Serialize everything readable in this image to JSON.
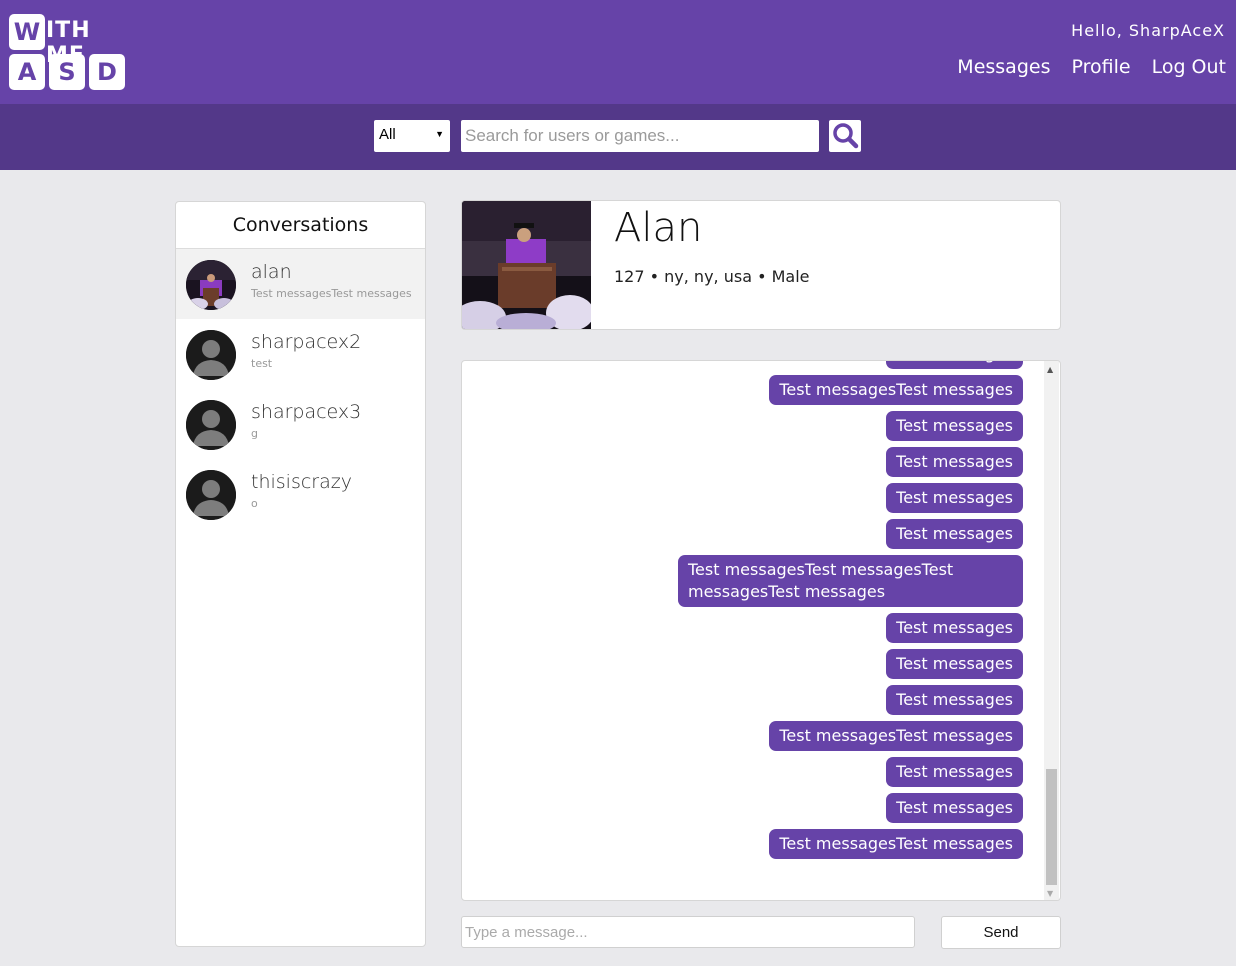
{
  "header": {
    "logo": {
      "tile_w": "W",
      "word": "ITH ME",
      "tiles": [
        "A",
        "S",
        "D"
      ]
    },
    "greeting": "Hello, SharpAceX",
    "nav": [
      "Messages",
      "Profile",
      "Log Out"
    ]
  },
  "search": {
    "category": "All",
    "placeholder": "Search for users or games..."
  },
  "conversations": {
    "title": "Conversations",
    "items": [
      {
        "name": "alan",
        "preview": "Test messagesTest messages"
      },
      {
        "name": "sharpacex2",
        "preview": "test"
      },
      {
        "name": "sharpacex3",
        "preview": "g"
      },
      {
        "name": "thisiscrazy",
        "preview": "o"
      }
    ]
  },
  "profile": {
    "name": "Alan",
    "info": "127 • ny, ny, usa • Male"
  },
  "messages": [
    "Test messages",
    "Test messagesTest messages",
    "Test messages",
    "Test messages",
    "Test messages",
    "Test messages",
    "Test messagesTest messagesTest messagesTest messages",
    "Test messages",
    "Test messages",
    "Test messages",
    "Test messagesTest messages",
    "Test messages",
    "Test messages",
    "Test messagesTest messages"
  ],
  "composer": {
    "placeholder": "Type a message...",
    "send_label": "Send"
  },
  "colors": {
    "header": "#6643a8",
    "searchbar": "#533889",
    "bubble": "#6643a8",
    "background": "#e9e9ec"
  }
}
